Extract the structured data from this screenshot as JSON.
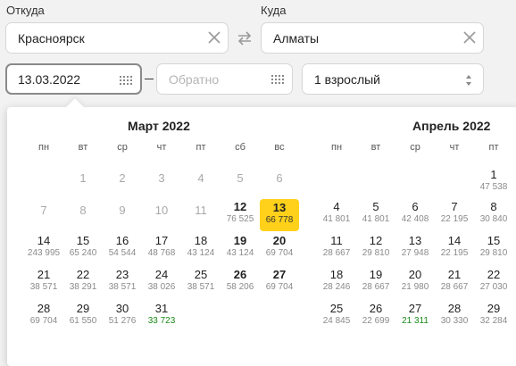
{
  "search": {
    "from_label": "Откуда",
    "to_label": "Куда",
    "from_value": "Красноярск",
    "to_value": "Алматы",
    "depart_value": "13.03.2022",
    "return_placeholder": "Обратно",
    "passengers_value": "1 взрослый"
  },
  "icons": {
    "clear": "close-icon",
    "swap": "swap-arrows-icon",
    "calendar": "calendar-grid-icon",
    "select": "up-down-chevron-icon"
  },
  "colors": {
    "selected": "#ffd11a",
    "lowest_price": "#1a8a1a"
  },
  "calendar": {
    "weekdays": [
      "пн",
      "вт",
      "ср",
      "чт",
      "пт",
      "сб",
      "вс"
    ],
    "months": [
      {
        "title": "Март 2022",
        "weeks": [
          [
            {
              "d": ""
            },
            {
              "d": "1",
              "past": true
            },
            {
              "d": "2",
              "past": true
            },
            {
              "d": "3",
              "past": true
            },
            {
              "d": "4",
              "past": true
            },
            {
              "d": "5",
              "past": true
            },
            {
              "d": "6",
              "past": true
            }
          ],
          [
            {
              "d": "7",
              "past": true
            },
            {
              "d": "8",
              "past": true
            },
            {
              "d": "9",
              "past": true
            },
            {
              "d": "10",
              "past": true
            },
            {
              "d": "11",
              "past": true
            },
            {
              "d": "12",
              "p": "76 525",
              "bold": true
            },
            {
              "d": "13",
              "p": "66 778",
              "bold": true,
              "sel": true
            }
          ],
          [
            {
              "d": "14",
              "p": "243 995"
            },
            {
              "d": "15",
              "p": "65 240"
            },
            {
              "d": "16",
              "p": "54 544"
            },
            {
              "d": "17",
              "p": "48 768"
            },
            {
              "d": "18",
              "p": "43 124"
            },
            {
              "d": "19",
              "p": "43 124",
              "bold": true
            },
            {
              "d": "20",
              "p": "69 704",
              "bold": true
            }
          ],
          [
            {
              "d": "21",
              "p": "38 571"
            },
            {
              "d": "22",
              "p": "38 291"
            },
            {
              "d": "23",
              "p": "38 571"
            },
            {
              "d": "24",
              "p": "38 026"
            },
            {
              "d": "25",
              "p": "38 571"
            },
            {
              "d": "26",
              "p": "58 206",
              "bold": true
            },
            {
              "d": "27",
              "p": "69 704",
              "bold": true
            }
          ],
          [
            {
              "d": "28",
              "p": "69 704"
            },
            {
              "d": "29",
              "p": "61 550"
            },
            {
              "d": "30",
              "p": "51 276"
            },
            {
              "d": "31",
              "p": "33 723",
              "low": true
            },
            {
              "d": ""
            },
            {
              "d": ""
            },
            {
              "d": ""
            }
          ]
        ]
      },
      {
        "title": "Апрель 2022",
        "weeks": [
          [
            {
              "d": ""
            },
            {
              "d": ""
            },
            {
              "d": ""
            },
            {
              "d": ""
            },
            {
              "d": "1",
              "p": "47 538"
            }
          ],
          [
            {
              "d": "4",
              "p": "41 801"
            },
            {
              "d": "5",
              "p": "41 801"
            },
            {
              "d": "6",
              "p": "42 408"
            },
            {
              "d": "7",
              "p": "22 195"
            },
            {
              "d": "8",
              "p": "30 840"
            }
          ],
          [
            {
              "d": "11",
              "p": "28 667"
            },
            {
              "d": "12",
              "p": "29 810"
            },
            {
              "d": "13",
              "p": "27 948"
            },
            {
              "d": "14",
              "p": "22 195"
            },
            {
              "d": "15",
              "p": "29 810"
            }
          ],
          [
            {
              "d": "18",
              "p": "28 246"
            },
            {
              "d": "19",
              "p": "28 667"
            },
            {
              "d": "20",
              "p": "21 980"
            },
            {
              "d": "21",
              "p": "28 667"
            },
            {
              "d": "22",
              "p": "27 030"
            }
          ],
          [
            {
              "d": "25",
              "p": "24 845"
            },
            {
              "d": "26",
              "p": "22 699"
            },
            {
              "d": "27",
              "p": "21 311",
              "low": true
            },
            {
              "d": "28",
              "p": "30 330"
            },
            {
              "d": "29",
              "p": "32 284"
            }
          ]
        ]
      }
    ]
  }
}
